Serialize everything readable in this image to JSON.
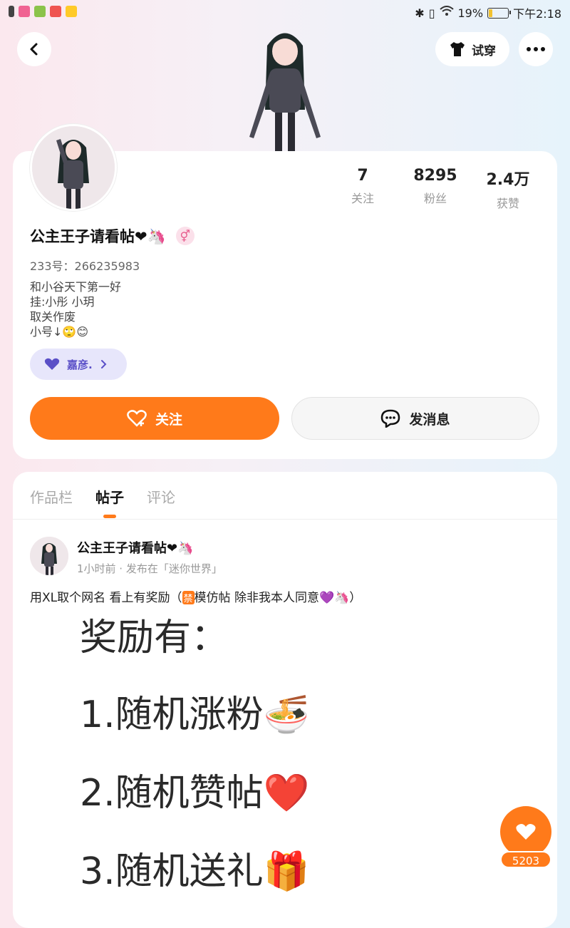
{
  "status_bar": {
    "battery": "19%",
    "time": "下午2:18"
  },
  "header": {
    "try_on_label": "试穿"
  },
  "profile": {
    "stats": [
      {
        "value": "7",
        "label": "关注"
      },
      {
        "value": "8295",
        "label": "粉丝"
      },
      {
        "value": "2.4万",
        "label": "获赞"
      }
    ],
    "nickname": "公主王子请看帖❤🦄",
    "gender_symbol": "⚥",
    "user_id": "233号：266235983",
    "bio": [
      "和小谷天下第一好",
      "挂:小彤 小玥",
      "取关作废",
      "小号↓🙄😊"
    ],
    "fan_badge": "嘉彦.",
    "follow_label": "关注",
    "message_label": "发消息"
  },
  "tabs": [
    {
      "label": "作品栏"
    },
    {
      "label": "帖子"
    },
    {
      "label": "评论"
    }
  ],
  "post": {
    "author": "公主王子请看帖❤🦄",
    "meta": "1小时前 · 发布在「迷你世界」",
    "text_before": "用XL取个网名 看上有奖励（",
    "forbid_label": "禁",
    "text_after": "模仿帖 除非我本人同意💜🦄）",
    "image_lines": [
      "奖励有：",
      "1.随机涨粉🍜",
      "2.随机赞帖❤️",
      "3.随机送礼🎁"
    ]
  },
  "like_count": "5203",
  "colors": {
    "accent": "#ff7a1a",
    "badge_bg": "#e7e6fb",
    "badge_text": "#5a4fc7"
  }
}
